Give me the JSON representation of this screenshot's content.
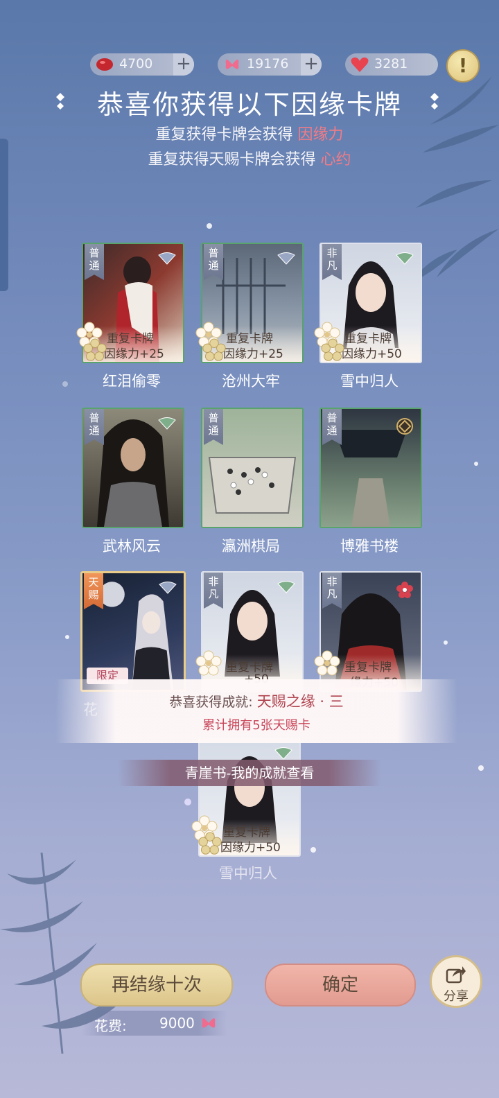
{
  "currencies": [
    {
      "name": "red-bean",
      "value": "4700",
      "plus": "+"
    },
    {
      "name": "butterfly",
      "value": "19176",
      "plus": "+"
    },
    {
      "name": "heart",
      "value": "3281"
    }
  ],
  "alert_icon": "!",
  "title": "恭喜你获得以下因缘卡牌",
  "subtitle1": {
    "text": "重复获得卡牌会获得 ",
    "highlight": "因缘力"
  },
  "subtitle2": {
    "text": "重复获得天赐卡牌会获得 ",
    "highlight": "心约"
  },
  "cards": [
    {
      "rarity": "普通",
      "name": "红泪偷零",
      "dup1": "重复卡牌",
      "dup2": "因缘力+25"
    },
    {
      "rarity": "普通",
      "name": "沧州大牢",
      "dup1": "重复卡牌",
      "dup2": "因缘力+25"
    },
    {
      "rarity": "非凡",
      "name": "雪中归人",
      "dup1": "重复卡牌",
      "dup2": "因缘力+50"
    },
    {
      "rarity": "普通",
      "name": "武林风云"
    },
    {
      "rarity": "普通",
      "name": "瀛洲棋局"
    },
    {
      "rarity": "普通",
      "name": "博雅书楼"
    },
    {
      "rarity": "天赐",
      "badge": "限定",
      "name": "花"
    },
    {
      "rarity": "非凡",
      "dup1": "重复卡牌",
      "dup2": "+50"
    },
    {
      "rarity": "非凡",
      "dup1": "重复卡牌",
      "dup2": "缘力+50"
    },
    {
      "rarity": "",
      "name": "雪中归人",
      "dup1": "重复卡牌",
      "dup2": "因缘力+50"
    }
  ],
  "achievement": {
    "prefix": "恭喜获得成就: ",
    "name": "天赐之缘 · 三",
    "desc": "累计拥有5张天赐卡"
  },
  "achievement_link": "青崖书-我的成就查看",
  "buttons": {
    "again": "再结缘十次",
    "confirm": "确定",
    "share": "分享"
  },
  "cost": {
    "label": "花费:",
    "value": "9000"
  },
  "colors": {
    "highlight": "#f27c86",
    "accent_gold": "#dcc58a",
    "accent_pink": "#e29b90"
  }
}
